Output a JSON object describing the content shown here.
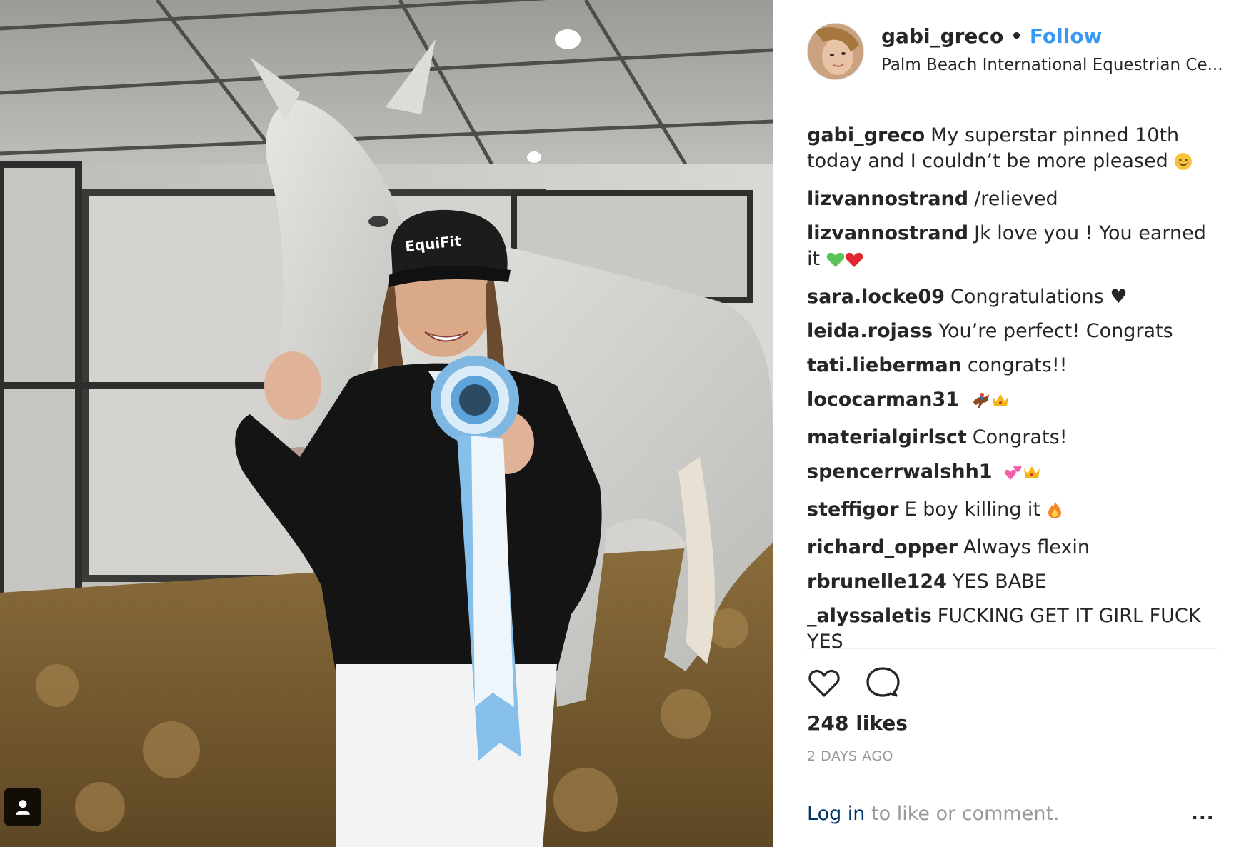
{
  "post_author": {
    "username": "gabi_greco",
    "separator": "•",
    "follow_label": "Follow",
    "location": "Palm Beach International Equestrian Ce..."
  },
  "photo": {
    "cap_text": "EquiFit"
  },
  "comments": [
    {
      "user": "gabi_greco",
      "text": "My superstar pinned 10th today and I couldn’t be more pleased",
      "emoji": [
        "smiling-face"
      ]
    },
    {
      "user": "lizvannostrand",
      "text": "/relieved",
      "emoji": []
    },
    {
      "user": "lizvannostrand",
      "text": "Jk love you ! You earned it",
      "emoji": [
        "green-heart",
        "red-heart"
      ]
    },
    {
      "user": "sara.locke09",
      "text": "Congratulations ♥",
      "emoji": []
    },
    {
      "user": "leida.rojass",
      "text": "You’re perfect! Congrats",
      "emoji": []
    },
    {
      "user": "tati.lieberman",
      "text": "congrats!!",
      "emoji": []
    },
    {
      "user": "lococarman31",
      "text": "",
      "emoji": [
        "horse-racing",
        "crown"
      ]
    },
    {
      "user": "materialgirlsct",
      "text": "Congrats!",
      "emoji": []
    },
    {
      "user": "spencerrwalshh1",
      "text": "",
      "emoji": [
        "two-hearts",
        "crown"
      ]
    },
    {
      "user": "steffigor",
      "text": "E boy killing it",
      "emoji": [
        "fire"
      ]
    },
    {
      "user": "richard_opper",
      "text": "Always flexin",
      "emoji": []
    },
    {
      "user": "rbrunelle124",
      "text": "YES BABE",
      "emoji": []
    },
    {
      "user": "_alyssaletis",
      "text": "FUCKING GET IT GIRL FUCK YES",
      "emoji": []
    }
  ],
  "actions": {
    "like_icon": "heart-icon",
    "comment_icon": "comment-icon"
  },
  "likes_label": "248 likes",
  "time_label": "2 DAYS AGO",
  "footer": {
    "login_label": "Log in",
    "login_suffix": " to like or comment.",
    "more_label": "..."
  },
  "colors": {
    "link_blue": "#3897f0",
    "login_blue": "#003569",
    "muted": "#999999",
    "text": "#262626"
  }
}
